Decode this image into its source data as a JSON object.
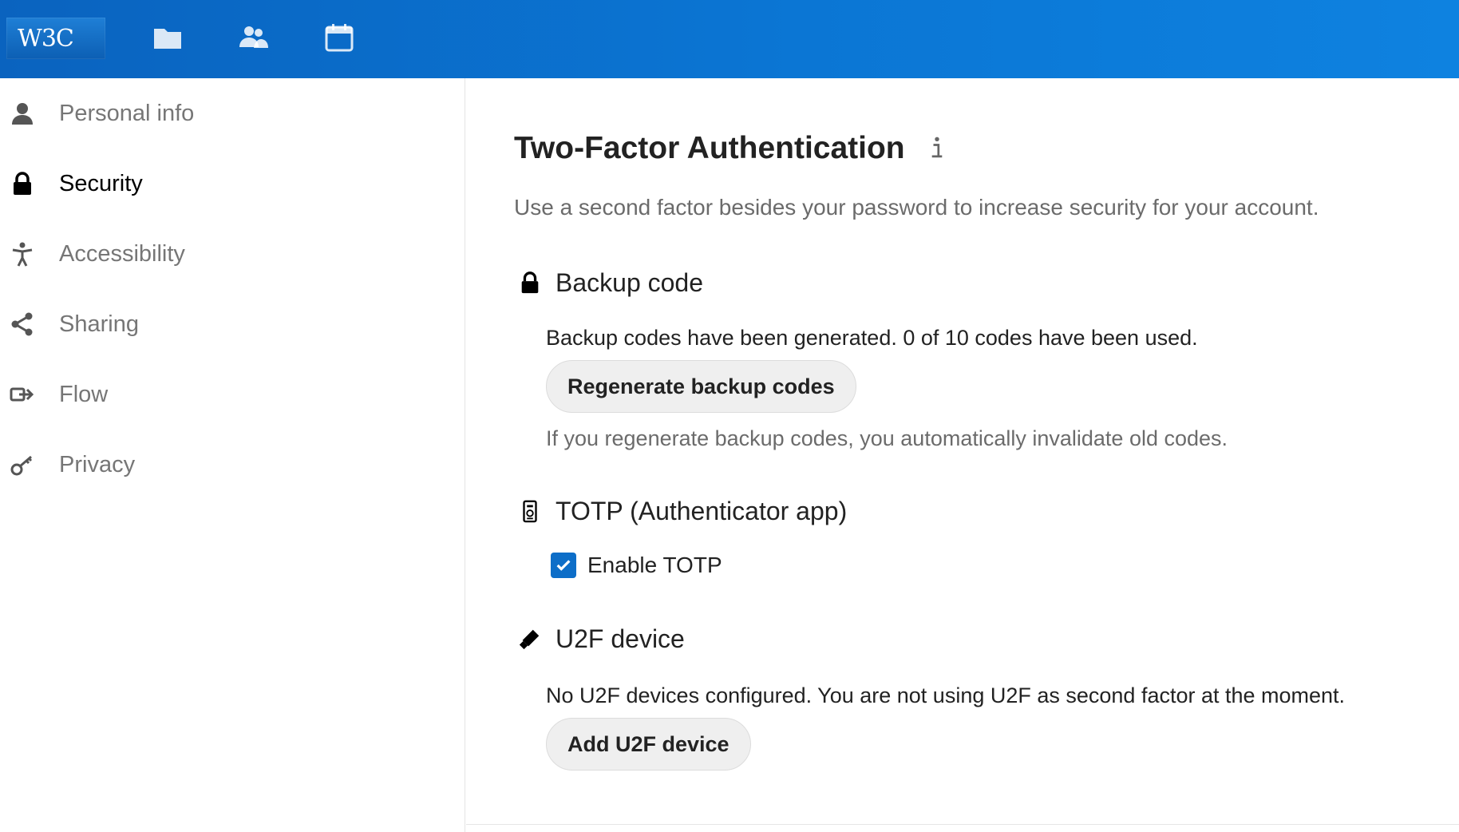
{
  "header": {
    "logo_text": "W3C",
    "apps": [
      {
        "name": "files",
        "icon": "folder-icon"
      },
      {
        "name": "contacts",
        "icon": "contacts-icon"
      },
      {
        "name": "calendar",
        "icon": "calendar-icon"
      }
    ],
    "colors": {
      "bar": "#0b76d4",
      "accent": "#0d6ec8"
    }
  },
  "sidebar": {
    "items": [
      {
        "label": "Personal info",
        "icon": "user-icon",
        "active": false
      },
      {
        "label": "Security",
        "icon": "lock-icon",
        "active": true
      },
      {
        "label": "Accessibility",
        "icon": "accessibility-icon",
        "active": false
      },
      {
        "label": "Sharing",
        "icon": "share-icon",
        "active": false
      },
      {
        "label": "Flow",
        "icon": "flow-icon",
        "active": false
      },
      {
        "label": "Privacy",
        "icon": "key-icon",
        "active": false
      }
    ]
  },
  "main": {
    "title": "Two-Factor Authentication",
    "description": "Use a second factor besides your password to increase security for your account.",
    "backup": {
      "heading": "Backup code",
      "status": "Backup codes have been generated. 0 of 10 codes have been used.",
      "button": "Regenerate backup codes",
      "note": "If you regenerate backup codes, you automatically invalidate old codes."
    },
    "totp": {
      "heading": "TOTP (Authenticator app)",
      "checkbox_label": "Enable TOTP",
      "checked": true
    },
    "u2f": {
      "heading": "U2F device",
      "status": "No U2F devices configured. You are not using U2F as second factor at the moment.",
      "button": "Add U2F device"
    }
  }
}
